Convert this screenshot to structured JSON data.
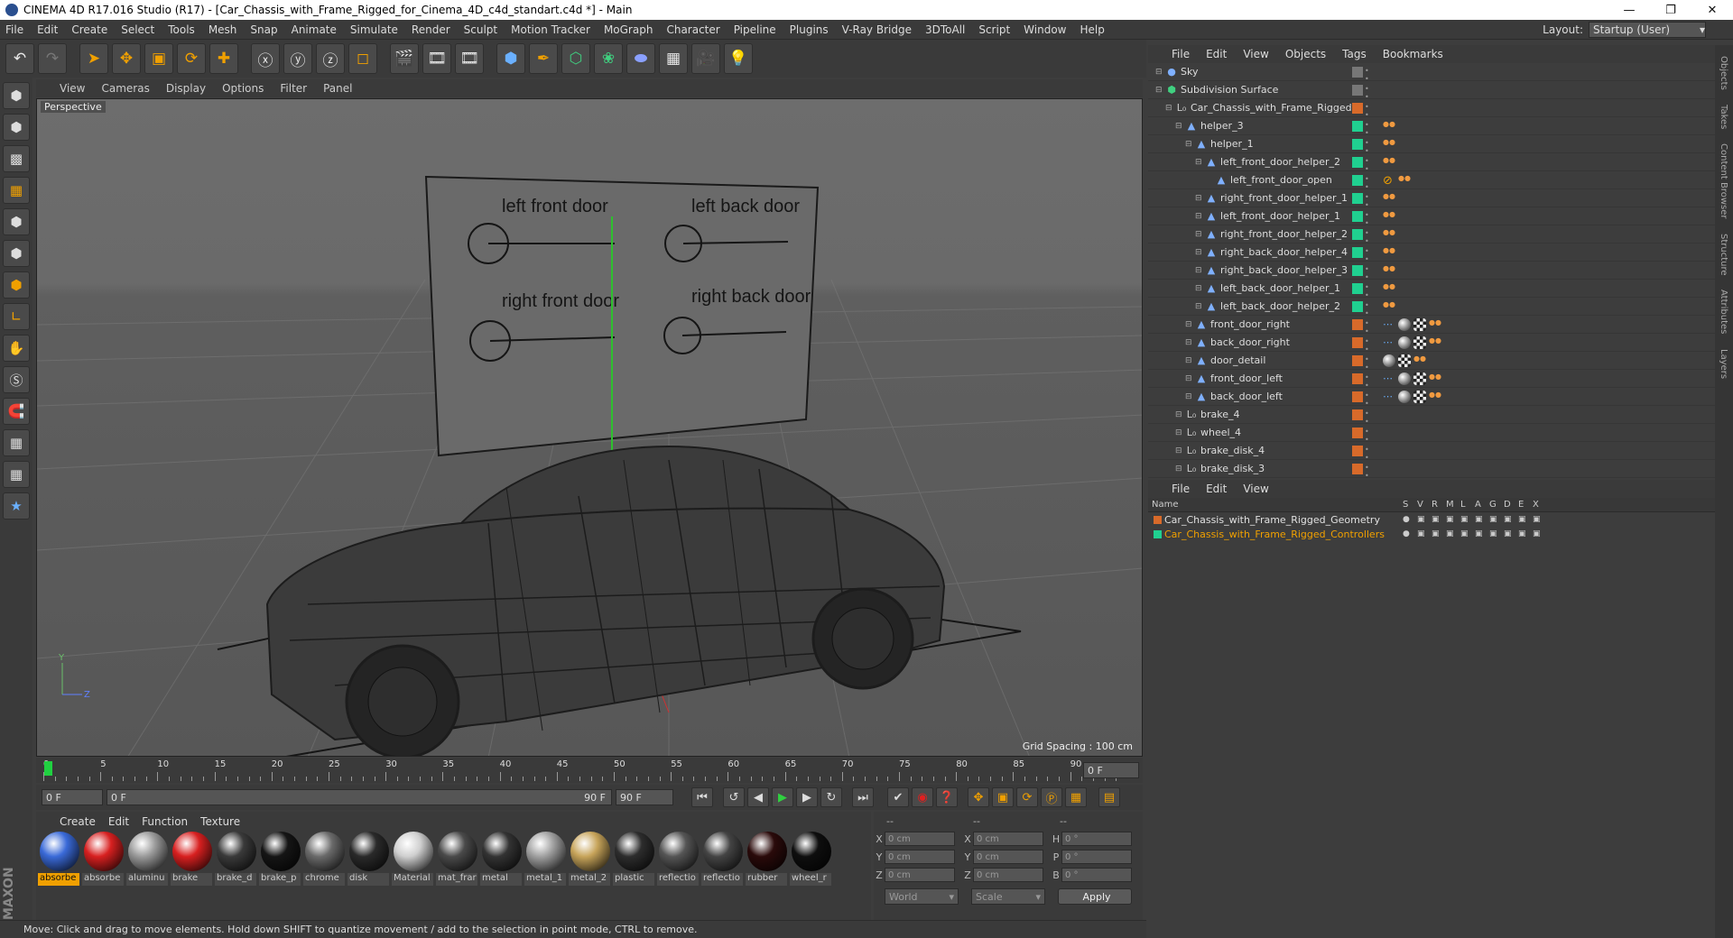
{
  "window": {
    "title": "CINEMA 4D R17.016 Studio (R17) - [Car_Chassis_with_Frame_Rigged_for_Cinema_4D_c4d_standart.c4d *] - Main"
  },
  "main_menu": [
    "File",
    "Edit",
    "Create",
    "Select",
    "Tools",
    "Mesh",
    "Snap",
    "Animate",
    "Simulate",
    "Render",
    "Sculpt",
    "Motion Tracker",
    "MoGraph",
    "Character",
    "Pipeline",
    "Plugins",
    "V-Ray Bridge",
    "3DToAll",
    "Script",
    "Window",
    "Help"
  ],
  "layout": {
    "label": "Layout:",
    "value": "Startup (User)"
  },
  "viewport": {
    "menu": [
      "View",
      "Cameras",
      "Display",
      "Options",
      "Filter",
      "Panel"
    ],
    "camera_label": "Perspective",
    "grid_spacing": "Grid Spacing : 100 cm",
    "board_labels": [
      "left front door",
      "left back door",
      "right front door",
      "right back door"
    ]
  },
  "timeline": {
    "ticks": [
      "0",
      "5",
      "10",
      "15",
      "20",
      "25",
      "30",
      "35",
      "40",
      "45",
      "50",
      "55",
      "60",
      "65",
      "70",
      "75",
      "80",
      "85",
      "90"
    ],
    "current_frame": "0 F",
    "start": "0 F",
    "range_start": "0 F",
    "range_end": "90 F",
    "end": "90 F"
  },
  "material_panel": {
    "menu": [
      "Create",
      "Edit",
      "Function",
      "Texture"
    ],
    "materials": [
      {
        "name": "absorbe",
        "color": "#3a6ad8"
      },
      {
        "name": "absorbe",
        "color": "#d82020"
      },
      {
        "name": "aluminu",
        "color": "#9a9a9a"
      },
      {
        "name": "brake",
        "color": "#d82020"
      },
      {
        "name": "brake_d",
        "color": "#3a3a3a"
      },
      {
        "name": "brake_p",
        "color": "#151515"
      },
      {
        "name": "chrome",
        "color": "#6a6a6a"
      },
      {
        "name": "disk",
        "color": "#2a2a2a"
      },
      {
        "name": "Material",
        "color": "#cfcfcf"
      },
      {
        "name": "mat_frar",
        "color": "#4a4a4a"
      },
      {
        "name": "metal",
        "color": "#333333"
      },
      {
        "name": "metal_1",
        "color": "#a0a0a0"
      },
      {
        "name": "metal_2",
        "color": "#c7a45a"
      },
      {
        "name": "plastic",
        "color": "#2d2d2d"
      },
      {
        "name": "reflectio",
        "color": "#555555"
      },
      {
        "name": "reflectio",
        "color": "#444444"
      },
      {
        "name": "rubber",
        "color": "#2a0a0a"
      },
      {
        "name": "wheel_r",
        "color": "#0e0e0e"
      }
    ]
  },
  "coordinates": {
    "headers": [
      "--",
      "--",
      "--"
    ],
    "rows": [
      {
        "a": "X",
        "v1": "0 cm",
        "b": "X",
        "v2": "0 cm",
        "c": "H",
        "v3": "0 °"
      },
      {
        "a": "Y",
        "v1": "0 cm",
        "b": "Y",
        "v2": "0 cm",
        "c": "P",
        "v3": "0 °"
      },
      {
        "a": "Z",
        "v1": "0 cm",
        "b": "Z",
        "v2": "0 cm",
        "c": "B",
        "v3": "0 °"
      }
    ],
    "mode": "World",
    "transform": "Scale",
    "apply": "Apply"
  },
  "status": "Move: Click and drag to move elements. Hold down SHIFT to quantize movement / add to the selection in point mode, CTRL to remove.",
  "object_manager": {
    "menu": [
      "File",
      "Edit",
      "View",
      "Objects",
      "Tags",
      "Bookmarks"
    ],
    "objects": [
      {
        "name": "Sky",
        "depth": 0,
        "icon": "sky",
        "color": "#777777",
        "tags": []
      },
      {
        "name": "Subdivision Surface",
        "depth": 0,
        "icon": "subdiv",
        "color": "#777777",
        "tags": []
      },
      {
        "name": "Car_Chassis_with_Frame_Rigged",
        "depth": 1,
        "icon": "null",
        "color": "#d86a2a",
        "tags": []
      },
      {
        "name": "helper_3",
        "depth": 2,
        "icon": "joint",
        "color": "#20d090",
        "tags": [
          "ik"
        ]
      },
      {
        "name": "helper_1",
        "depth": 3,
        "icon": "joint",
        "color": "#20d090",
        "tags": [
          "ik"
        ]
      },
      {
        "name": "left_front_door_helper_2",
        "depth": 4,
        "icon": "joint",
        "color": "#20d090",
        "tags": [
          "ik"
        ]
      },
      {
        "name": "left_front_door_open",
        "depth": 5,
        "icon": "joint",
        "color": "#20d090",
        "tags": [
          "lock",
          "ik"
        ]
      },
      {
        "name": "right_front_door_helper_1",
        "depth": 4,
        "icon": "joint",
        "color": "#20d090",
        "tags": [
          "ik"
        ]
      },
      {
        "name": "left_front_door_helper_1",
        "depth": 4,
        "icon": "joint",
        "color": "#20d090",
        "tags": [
          "ik"
        ]
      },
      {
        "name": "right_front_door_helper_2",
        "depth": 4,
        "icon": "joint",
        "color": "#20d090",
        "tags": [
          "ik"
        ]
      },
      {
        "name": "right_back_door_helper_4",
        "depth": 4,
        "icon": "joint",
        "color": "#20d090",
        "tags": [
          "ik"
        ]
      },
      {
        "name": "right_back_door_helper_3",
        "depth": 4,
        "icon": "joint",
        "color": "#20d090",
        "tags": [
          "ik"
        ]
      },
      {
        "name": "left_back_door_helper_1",
        "depth": 4,
        "icon": "joint",
        "color": "#20d090",
        "tags": [
          "ik"
        ]
      },
      {
        "name": "left_back_door_helper_2",
        "depth": 4,
        "icon": "joint",
        "color": "#20d090",
        "tags": [
          "ik"
        ]
      },
      {
        "name": "front_door_right",
        "depth": 3,
        "icon": "joint",
        "color": "#d86a2a",
        "tags": [
          "dots",
          "sphere",
          "checker",
          "ik"
        ]
      },
      {
        "name": "back_door_right",
        "depth": 3,
        "icon": "joint",
        "color": "#d86a2a",
        "tags": [
          "dots",
          "sphere",
          "checker",
          "ik"
        ]
      },
      {
        "name": "door_detail",
        "depth": 3,
        "icon": "joint",
        "color": "#d86a2a",
        "tags": [
          "sphere",
          "checker",
          "ik"
        ]
      },
      {
        "name": "front_door_left",
        "depth": 3,
        "icon": "joint",
        "color": "#d86a2a",
        "tags": [
          "dots",
          "sphere",
          "checker",
          "ik"
        ]
      },
      {
        "name": "back_door_left",
        "depth": 3,
        "icon": "joint",
        "color": "#d86a2a",
        "tags": [
          "dots",
          "sphere",
          "checker",
          "ik"
        ]
      },
      {
        "name": "brake_4",
        "depth": 2,
        "icon": "null",
        "color": "#d86a2a",
        "tags": []
      },
      {
        "name": "wheel_4",
        "depth": 2,
        "icon": "null",
        "color": "#d86a2a",
        "tags": []
      },
      {
        "name": "brake_disk_4",
        "depth": 2,
        "icon": "null",
        "color": "#d86a2a",
        "tags": []
      },
      {
        "name": "brake_disk_3",
        "depth": 2,
        "icon": "null",
        "color": "#d86a2a",
        "tags": []
      }
    ]
  },
  "layer_manager": {
    "menu": [
      "File",
      "Edit",
      "View"
    ],
    "columns": [
      "Name",
      "S",
      "V",
      "R",
      "M",
      "L",
      "A",
      "G",
      "D",
      "E",
      "X"
    ],
    "layers": [
      {
        "name": "Car_Chassis_with_Frame_Rigged_Geometry",
        "color": "#d86a2a",
        "text_color": "#e0e0e0"
      },
      {
        "name": "Car_Chassis_with_Frame_Rigged_Controllers",
        "color": "#20d090",
        "text_color": "#f0a000"
      }
    ]
  },
  "side_tabs": [
    "Objects",
    "Takes",
    "Content Browser",
    "Structure",
    "Attributes",
    "Layers"
  ]
}
